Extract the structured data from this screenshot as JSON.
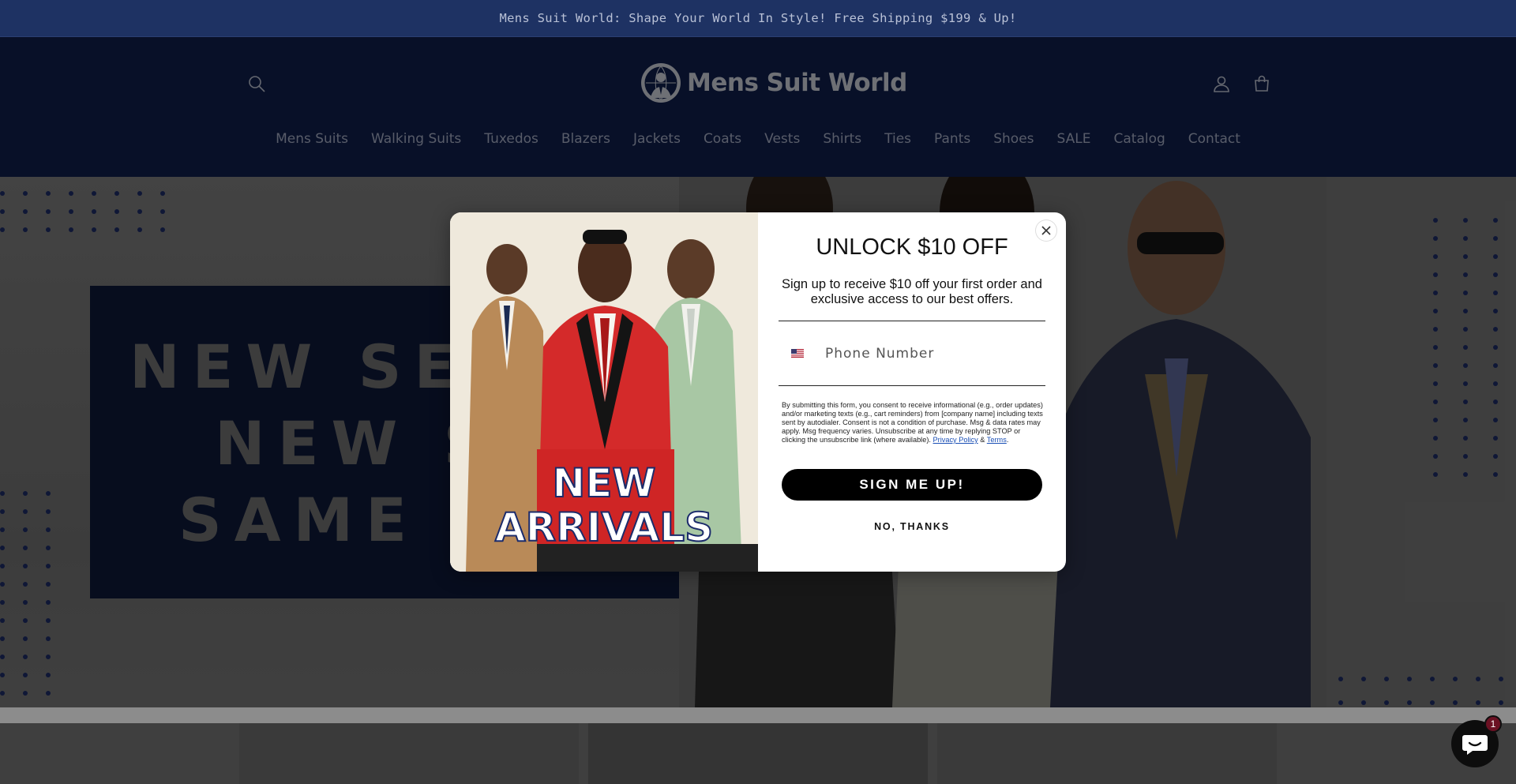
{
  "announcement": {
    "text": "Mens Suit World: Shape Your World In Style! Free Shipping $199 & Up!"
  },
  "header": {
    "logo_text": "Mens Suit World",
    "icons": {
      "search": "search-icon",
      "account": "user-icon",
      "cart": "bag-icon"
    },
    "nav": [
      "Mens Suits",
      "Walking Suits",
      "Tuxedos",
      "Blazers",
      "Jackets",
      "Coats",
      "Vests",
      "Shirts",
      "Ties",
      "Pants",
      "Shoes",
      "SALE",
      "Catalog",
      "Contact"
    ]
  },
  "hero": {
    "banner_lines": [
      "NEW SEASON",
      "NEW STYLES",
      "SAME PRICES"
    ]
  },
  "modal": {
    "image_text": [
      "NEW",
      "ARRIVALS"
    ],
    "title": "UNLOCK $10 OFF",
    "subtitle": "Sign up to receive $10 off your first order and exclusive access to our best offers.",
    "phone_placeholder": "Phone Number",
    "country_flag": "us-flag-icon",
    "legal_text": "By submitting this form, you consent to receive informational (e.g., order updates) and/or marketing texts (e.g., cart reminders) from [company name] including texts sent by autodialer. Consent is not a condition of purchase. Msg & data rates may apply. Msg frequency varies. Unsubscribe at any time by replying STOP or clicking the unsubscribe link (where available).",
    "privacy_link": "Privacy Policy",
    "and_text": "&",
    "terms_link": "Terms",
    "period": ".",
    "signup_label": "SIGN ME UP!",
    "no_thanks_label": "NO, THANKS",
    "close_icon": "close-icon"
  },
  "chat": {
    "badge_count": "1",
    "icon": "chat-icon"
  },
  "colors": {
    "announce_bg": "#1e3263",
    "header_bg": "#0f1e4a",
    "button": "#000000",
    "badge": "#6b1123"
  }
}
